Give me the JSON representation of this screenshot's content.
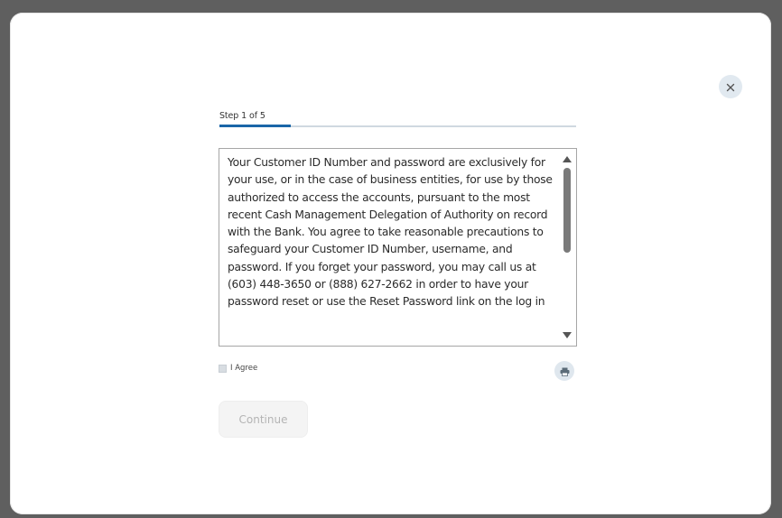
{
  "wizard": {
    "step_label": "Step 1 of 5",
    "progress_fraction": 0.2
  },
  "terms": {
    "text": "Your Customer ID Number and password are exclusively for your use, or in the case of business entities, for use by those authorized to access the accounts, pursuant to the most recent Cash Management Delegation of Authority on record with the Bank. You agree to take reasonable precautions to safeguard your Customer ID Number, username, and password. If you forget your password, you may call us at (603) 448-3650 or (888) 627-2662 in order to have your password reset or use the Reset Password link on the log in"
  },
  "agree": {
    "label": "I Agree",
    "checked": false
  },
  "actions": {
    "continue_label": "Continue",
    "continue_enabled": false
  },
  "icons": {
    "close": "close-icon",
    "print": "print-icon",
    "scroll_up": "scroll-up-arrow-icon",
    "scroll_down": "scroll-down-arrow-icon"
  },
  "colors": {
    "accent": "#1a66a8",
    "backdrop": "#5f5f5f",
    "icon_button_bg": "#e1e9f0"
  }
}
